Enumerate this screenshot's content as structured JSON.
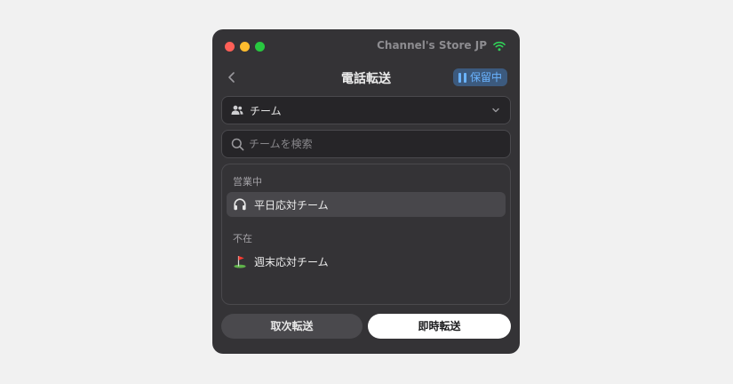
{
  "titlebar": {
    "store_name": "Channel's Store JP",
    "status_icon": "wifi-icon"
  },
  "nav": {
    "title": "電話転送",
    "back_icon": "chevron-left-icon",
    "hold_badge": "保留中",
    "hold_icon": "pause-icon"
  },
  "team_select": {
    "icon": "people-icon",
    "value": "チーム",
    "chevron_icon": "chevron-down-icon"
  },
  "search": {
    "icon": "search-icon",
    "placeholder": "チームを検索",
    "value": ""
  },
  "sections": [
    {
      "label": "営業中",
      "items": [
        {
          "label": "平日応対チーム",
          "icon": "headphones-icon",
          "selected": true
        }
      ]
    },
    {
      "label": "不在",
      "items": [
        {
          "label": "週末応対チーム",
          "icon": "golf-flag-icon",
          "emoji": "⛳",
          "selected": false
        }
      ]
    }
  ],
  "actions": {
    "cancel_label": "取次転送",
    "primary_label": "即時転送"
  },
  "colors": {
    "window_bg": "#343336",
    "accent_blue": "#6ab3ff",
    "badge_bg": "#3c5a7e",
    "wifi_green": "#30d158"
  }
}
